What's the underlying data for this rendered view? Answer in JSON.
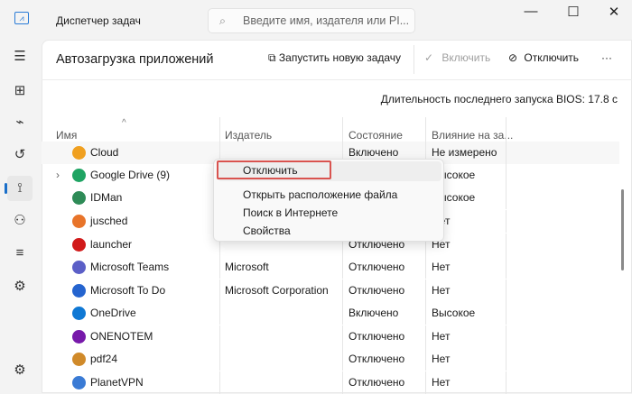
{
  "window": {
    "title": "Диспетчер задач",
    "search_placeholder": "Введите имя, издателя или PI...",
    "minimize": "—",
    "maximize": "☐",
    "close": "✕"
  },
  "sidebar": {
    "items": [
      {
        "name": "menu",
        "glyph": "☰"
      },
      {
        "name": "processes",
        "glyph": "⊞"
      },
      {
        "name": "performance",
        "glyph": "⌁"
      },
      {
        "name": "history",
        "glyph": "↺"
      },
      {
        "name": "startup",
        "glyph": "⟟"
      },
      {
        "name": "users",
        "glyph": "⚇"
      },
      {
        "name": "details",
        "glyph": "≡"
      },
      {
        "name": "services",
        "glyph": "⚙"
      },
      {
        "name": "settings",
        "glyph": "⚙"
      }
    ]
  },
  "header": {
    "title": "Автозагрузка приложений",
    "run_task": "Запустить новую задачу",
    "enable": "Включить",
    "disable": "Отключить",
    "more": "···"
  },
  "bios": "Длительность последнего запуска BIOS: 17.8 с",
  "columns": [
    "Имя",
    "Издатель",
    "Состояние",
    "Влияние на за..."
  ],
  "rows": [
    {
      "name": "Cloud",
      "publisher": "",
      "state": "Включено",
      "impact": "Не измерено",
      "color": "#f0a020"
    },
    {
      "name": "Google Drive (9)",
      "publisher": "",
      "state": "",
      "impact": "Высокое",
      "color": "#1fa463",
      "expand": "›"
    },
    {
      "name": "IDMan",
      "publisher": "",
      "state": "",
      "impact": "Высокое",
      "color": "#2e8b57"
    },
    {
      "name": "jusched",
      "publisher": "",
      "state": "",
      "impact": "Нет",
      "color": "#e8742a"
    },
    {
      "name": "launcher",
      "publisher": "",
      "state": "Отключено",
      "impact": "Нет",
      "color": "#d11a1a"
    },
    {
      "name": "Microsoft Teams",
      "publisher": "Microsoft",
      "state": "Отключено",
      "impact": "Нет",
      "color": "#5b5fc7"
    },
    {
      "name": "Microsoft To Do",
      "publisher": "Microsoft Corporation",
      "state": "Отключено",
      "impact": "Нет",
      "color": "#2564cf"
    },
    {
      "name": "OneDrive",
      "publisher": "",
      "state": "Включено",
      "impact": "Высокое",
      "color": "#0f78d4"
    },
    {
      "name": "ONENOTEM",
      "publisher": "",
      "state": "Отключено",
      "impact": "Нет",
      "color": "#7719aa"
    },
    {
      "name": "pdf24",
      "publisher": "",
      "state": "Отключено",
      "impact": "Нет",
      "color": "#d08a2a"
    },
    {
      "name": "PlanetVPN",
      "publisher": "",
      "state": "Отключено",
      "impact": "Нет",
      "color": "#3a7bd5"
    }
  ],
  "context_menu": [
    "Отключить",
    "Открыть расположение файла",
    "Поиск в Интернете",
    "Свойства"
  ]
}
